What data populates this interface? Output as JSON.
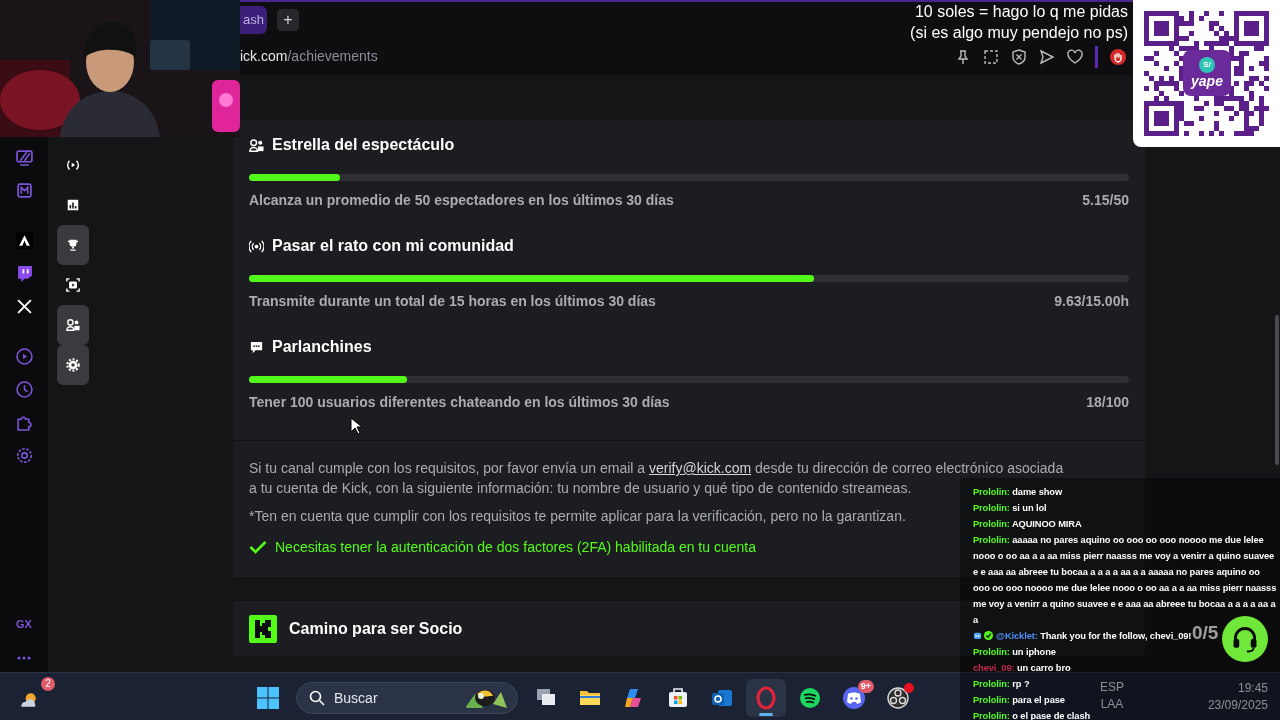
{
  "overlay_text": [
    "10 soles = hago lo q me pidas",
    "(si es algo muy pendejo no ps)"
  ],
  "qr_card": {
    "badge": "S/",
    "logo": "yape"
  },
  "browser": {
    "tab": "ash",
    "new_tab": "+",
    "address_host": "ick.com",
    "address_path": "/achievements",
    "toolbar": [
      {
        "kind": "pin"
      },
      {
        "kind": "snapshot"
      },
      {
        "kind": "shield"
      },
      {
        "kind": "send"
      },
      {
        "kind": "heart"
      },
      {
        "kind": "stop"
      }
    ]
  },
  "browser_sidebar": {
    "groups": [
      [
        {
          "kind": "screen"
        },
        {
          "kind": "memo"
        }
      ],
      [
        {
          "kind": "kick"
        },
        {
          "kind": "twitch"
        },
        {
          "kind": "x"
        }
      ],
      [
        {
          "kind": "player"
        },
        {
          "kind": "history"
        },
        {
          "kind": "extensions"
        },
        {
          "kind": "settings"
        }
      ]
    ],
    "brand": "GX"
  },
  "dashboard_nav": [
    {
      "kind": "live",
      "selected": false
    },
    {
      "kind": "analytics",
      "selected": false
    },
    {
      "kind": "achievements",
      "selected": true
    },
    {
      "kind": "clips",
      "selected": false
    },
    {
      "kind": "community",
      "selected": true
    },
    {
      "kind": "settings",
      "selected": true
    }
  ],
  "achievements": [
    {
      "kind": "viewers",
      "title": "Estrella del espectáculo",
      "description": "Alcanza un promedio de 50 espectadores en los últimos 30 días",
      "progress": "5.15/50",
      "level": 0.103
    },
    {
      "kind": "broadcast",
      "title": "Pasar el rato con mi comunidad",
      "description": "Transmite durante un total de 15 horas en los últimos 30 días",
      "progress": "9.63/15.00h",
      "level": 0.642
    },
    {
      "kind": "chat",
      "title": "Parlanchines",
      "description": "Tener 100 usuarios diferentes chateando en los últimos 30 días",
      "progress": "18/100",
      "level": 0.18
    }
  ],
  "verification": {
    "text_before": "Si tu canal cumple con los requisitos, por favor envía un email a ",
    "link": "verify@kick.com",
    "text_after": " desde tu dirección de correo electrónico asociada",
    "text_line2": "a tu cuenta de Kick, con la siguiente información: tu nombre de usuario y qué tipo de contenido streameas.",
    "note": "*Ten en cuenta que cumplir con los requisitos te permite aplicar para la verificación, pero no la garantizan.",
    "requirement": {
      "text": "Necesitas tener la autenticación de dos factores (2FA) habilitada en tu cuenta",
      "met": true
    }
  },
  "partner_path": {
    "title": "Camino para ser Socio"
  },
  "chat": {
    "counter": "0/5",
    "messages": [
      {
        "kind": "user",
        "user": "Prololin:",
        "color": "#53fc18",
        "text": "dame show"
      },
      {
        "kind": "user",
        "user": "Prololin:",
        "color": "#53fc18",
        "text": "si un lol"
      },
      {
        "kind": "user",
        "user": "Prololin:",
        "color": "#53fc18",
        "text": "AQUINOO MIRA"
      },
      {
        "kind": "user",
        "user": "Prololin:",
        "color": "#53fc18",
        "text": "aaaaa no pares aquino oo ooo oo ooo noooo me due lelee nooo o oo aa a a aa miss pierr naasss me voy a venirr a quino suavee e e aaa aa abreee tu bocaa a a a a aa a a aaaaa no pares aquino oo ooo oo ooo noooo me due lelee nooo o oo aa a a aa miss pierr naasss me voy a venirr a quino suavee e e aaa aa abreee tu bocaa a a a a aa a a"
      },
      {
        "kind": "bot",
        "user": "@Kicklet:",
        "color": "#4d8ef7",
        "text": "Thank you for the follow, chevi_09!"
      },
      {
        "kind": "user",
        "user": "Prololin:",
        "color": "#53fc18",
        "text": "un iphone"
      },
      {
        "kind": "user",
        "user": "chevi_09:",
        "color": "#c2284f",
        "text": "un carro bro"
      },
      {
        "kind": "user",
        "user": "Prololin:",
        "color": "#53fc18",
        "text": "rp ?"
      },
      {
        "kind": "user",
        "user": "Prololin:",
        "color": "#53fc18",
        "text": "para el pase"
      },
      {
        "kind": "user",
        "user": "Prololin:",
        "color": "#53fc18",
        "text": "o el pase de clash"
      }
    ]
  },
  "taskbar": {
    "weather_badge": "2",
    "search_label": "Buscar",
    "apps": [
      {
        "kind": "task-view",
        "active": false
      },
      {
        "kind": "files",
        "active": false
      },
      {
        "kind": "copilot",
        "active": false
      },
      {
        "kind": "store",
        "active": false
      },
      {
        "kind": "outlook",
        "active": false
      },
      {
        "kind": "opera",
        "active": true
      },
      {
        "kind": "spotify",
        "active": false
      },
      {
        "kind": "discord",
        "active": false,
        "badge": "9+"
      },
      {
        "kind": "obs",
        "active": false,
        "dot": true
      }
    ],
    "language": [
      "ESP",
      "LAA"
    ],
    "time": "19:45",
    "date": "23/09/2025"
  }
}
